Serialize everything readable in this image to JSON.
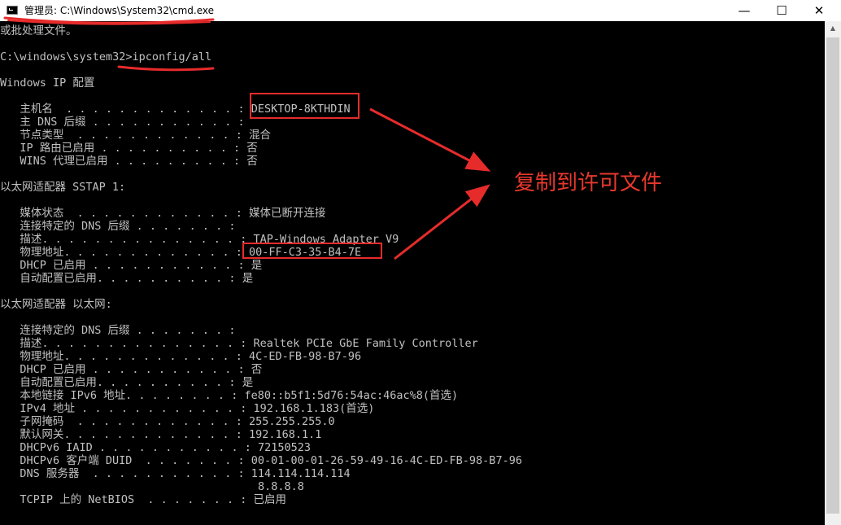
{
  "window": {
    "title": "管理员: C:\\Windows\\System32\\cmd.exe",
    "minimize_icon": "—",
    "maximize_icon": "☐",
    "close_icon": "✕"
  },
  "console": {
    "lines": [
      "或批处理文件。",
      "",
      "C:\\windows\\system32>ipconfig/all",
      "",
      "Windows IP 配置",
      "",
      "   主机名  . . . . . . . . . . . . . : DESKTOP-8KTHDIN",
      "   主 DNS 后缀 . . . . . . . . . . . :",
      "   节点类型  . . . . . . . . . . . . : 混合",
      "   IP 路由已启用 . . . . . . . . . . : 否",
      "   WINS 代理已启用 . . . . . . . . . : 否",
      "",
      "以太网适配器 SSTAP 1:",
      "",
      "   媒体状态  . . . . . . . . . . . . : 媒体已断开连接",
      "   连接特定的 DNS 后缀 . . . . . . . :",
      "   描述. . . . . . . . . . . . . . . : TAP-Windows Adapter V9",
      "   物理地址. . . . . . . . . . . . . : 00-FF-C3-35-B4-7E",
      "   DHCP 已启用 . . . . . . . . . . . : 是",
      "   自动配置已启用. . . . . . . . . . : 是",
      "",
      "以太网适配器 以太网:",
      "",
      "   连接特定的 DNS 后缀 . . . . . . . :",
      "   描述. . . . . . . . . . . . . . . : Realtek PCIe GbE Family Controller",
      "   物理地址. . . . . . . . . . . . . : 4C-ED-FB-98-B7-96",
      "   DHCP 已启用 . . . . . . . . . . . : 否",
      "   自动配置已启用. . . . . . . . . . : 是",
      "   本地链接 IPv6 地址. . . . . . . . : fe80::b5f1:5d76:54ac:46ac%8(首选)",
      "   IPv4 地址 . . . . . . . . . . . . : 192.168.1.183(首选)",
      "   子网掩码  . . . . . . . . . . . . : 255.255.255.0",
      "   默认网关. . . . . . . . . . . . . : 192.168.1.1",
      "   DHCPv6 IAID . . . . . . . . . . . : 72150523",
      "   DHCPv6 客户端 DUID  . . . . . . . : 00-01-00-01-26-59-49-16-4C-ED-FB-98-B7-96",
      "   DNS 服务器  . . . . . . . . . . . : 114.114.114.114",
      "                                       8.8.8.8",
      "   TCPIP 上的 NetBIOS  . . . . . . . : 已启用"
    ]
  },
  "scrollbar": {
    "up_icon": "▲"
  },
  "annotation": {
    "text": "复制到许可文件",
    "color": "#e62b2b"
  }
}
